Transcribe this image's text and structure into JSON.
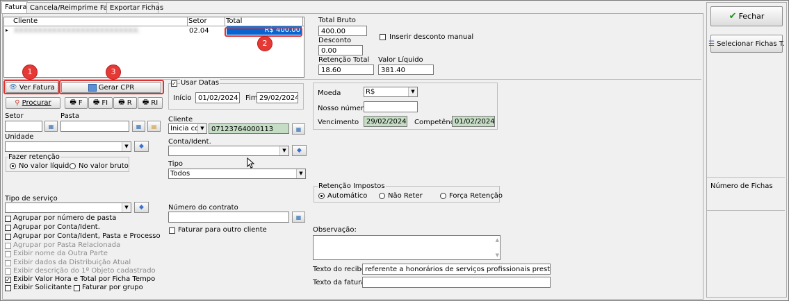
{
  "tabs": [
    "Fatura",
    "Cancela/Reimprime Fatura",
    "Exportar Fichas"
  ],
  "grid": {
    "columns": [
      "Cliente",
      "Setor",
      "Total"
    ],
    "row": {
      "cliente": "XXXXXXXXXXXXXXXXXXXXXXXXXXXXXXXX",
      "setor": "02.04",
      "total": "R$ 400.00"
    }
  },
  "totals": {
    "bruto_label": "Total Bruto",
    "bruto_value": "400.00",
    "desconto_label": "Desconto",
    "desconto_value": "0.00",
    "desconto_manual_label": "Inserir desconto manual",
    "retencao_label": "Retenção Total",
    "retencao_value": "18.60",
    "liquido_label": "Valor Líquido",
    "liquido_value": "381.40"
  },
  "badges": [
    "1",
    "2",
    "3"
  ],
  "buttons": {
    "ver_fatura": "Ver Fatura",
    "gerar_cpr": "Gerar CPR",
    "procurar": "Procurar",
    "print_f": "F",
    "print_fi": "FI",
    "print_r": "R",
    "print_ri": "RI",
    "fechar": "Fechar",
    "selecionar_fichas": "Selecionar Fichas T."
  },
  "filters": {
    "setor_label": "Setor",
    "pasta_label": "Pasta",
    "unidade_label": "Unidade",
    "fazer_retencao_label": "Fazer retenção",
    "radio_liquido": "No valor líquido",
    "radio_bruto": "No valor bruto",
    "tipo_servico_label": "Tipo de serviço",
    "checks": [
      {
        "label": "Agrupar por número de pasta",
        "checked": false,
        "disabled": false
      },
      {
        "label": "Agrupar por Conta/Ident.",
        "checked": false,
        "disabled": false
      },
      {
        "label": "Agrupar por Conta/Ident, Pasta e Processo",
        "checked": false,
        "disabled": false
      },
      {
        "label": "Agrupar por Pasta Relacionada",
        "checked": false,
        "disabled": true
      },
      {
        "label": "Exibir nome da Outra Parte",
        "checked": false,
        "disabled": true
      },
      {
        "label": "Exibir dados da Distribuição Atual",
        "checked": false,
        "disabled": true
      },
      {
        "label": "Exibir descrição do 1º Objeto cadastrado",
        "checked": false,
        "disabled": true
      },
      {
        "label": "Exibir Valor Hora e Total por Ficha Tempo",
        "checked": true,
        "disabled": false
      },
      {
        "label": "Exibir Solicitante",
        "checked": false,
        "disabled": false
      }
    ],
    "faturar_grupo_label": "Faturar por grupo"
  },
  "datas": {
    "usar_datas_label": "Usar Datas",
    "inicio_label": "Início",
    "inicio_value": "01/02/2024",
    "fim_label": "Fim",
    "fim_value": "29/02/2024"
  },
  "cliente": {
    "label": "Cliente",
    "mode": "Inicia com",
    "value": "07123764000113",
    "conta_label": "Conta/Ident.",
    "tipo_label": "Tipo",
    "tipo_value": "Todos",
    "contrato_label": "Número do contrato",
    "outro_cliente_label": "Faturar para outro cliente"
  },
  "moeda": {
    "moeda_label": "Moeda",
    "moeda_value": "R$",
    "nosso_numero_label": "Nosso número",
    "vencimento_label": "Vencimento",
    "vencimento_value": "29/02/2024",
    "competencia_label": "Competência",
    "competencia_value": "01/02/2024"
  },
  "retencao_impostos": {
    "label": "Retenção Impostos",
    "automatico": "Automático",
    "nao_reter": "Não Reter",
    "forca": "Força Retenção"
  },
  "observacao_label": "Observação:",
  "texto_recibo_label": "Texto do recibo:",
  "texto_recibo_value": "referente a honorários de serviços profissionais prestados.",
  "texto_fatura_label": "Texto da fatura:",
  "numero_fichas_label": "Número de Fichas"
}
